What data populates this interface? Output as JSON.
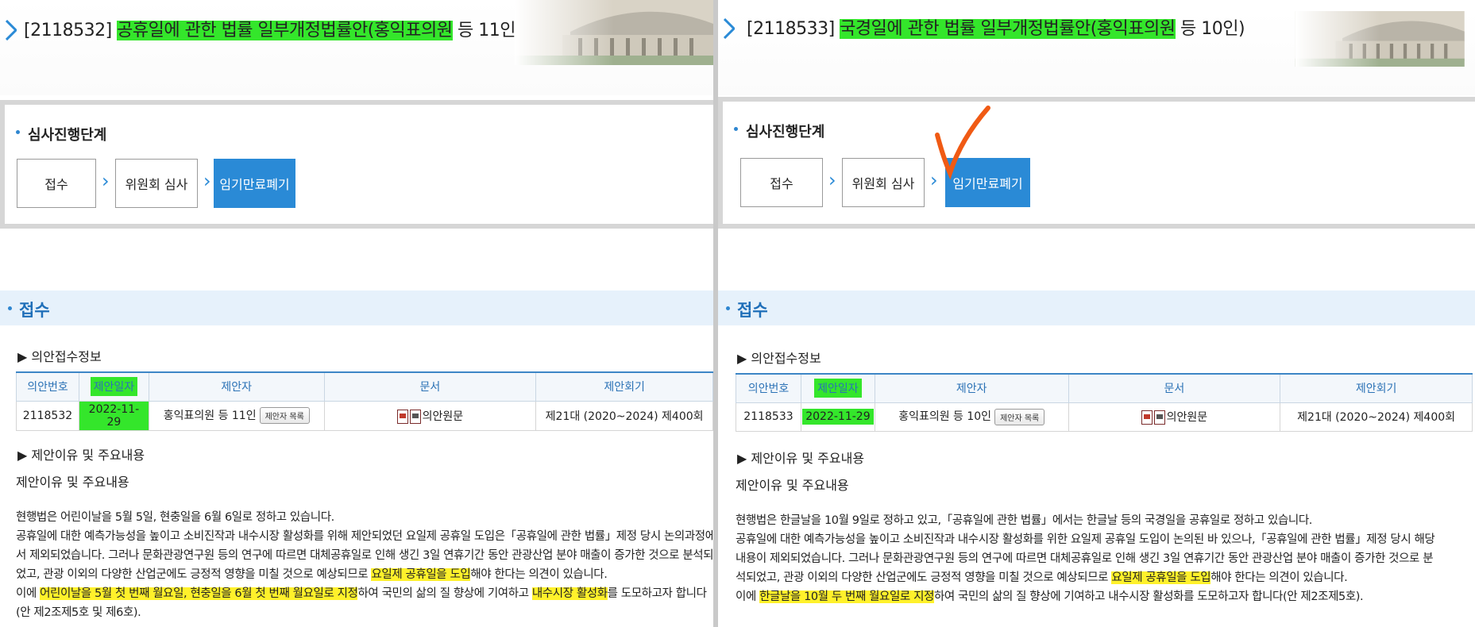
{
  "left": {
    "title_prefix": "[2118532] ",
    "title_highlighted": "공휴일에 관한 법률 일부개정법률안(홍익표의원",
    "title_suffix": " 등 11인)",
    "stage_heading": "심사진행단계",
    "stages": [
      "접수",
      "위원회 심사",
      "임기만료폐기"
    ],
    "section": "접수",
    "info_heading": "▶ 의안접수정보",
    "table_headers": [
      "의안번호",
      "제안일자",
      "제안자",
      "문서",
      "제안회기"
    ],
    "row": {
      "bill_no": "2118532",
      "date": "2022-11-29",
      "proposer": "홍익표의원 등 11인",
      "proposer_button": "제안자 목록",
      "doc": "의안원문",
      "session": "제21대 (2020~2024) 제400회"
    },
    "reason_heading": "▶ 제안이유 및 주요내용",
    "reason_label": "제안이유 및 주요내용",
    "line1": "현행법은 어린이날을 5월 5일, 현충일을 6월 6일로 정하고 있습니다.",
    "line2": "공휴일에 대한 예측가능성을 높이고 소비진작과 내수시장 활성화를 위해 제안되었던 요일제 공휴일 도입은「공휴일에 관한 법률」제정 당시 논의과정에",
    "line3": "서 제외되었습니다. 그러나 문화관광연구원 등의 연구에 따르면 대체공휴일로 인해 생긴 3일 연휴기간 동안 관광산업 분야 매출이 증가한 것으로 분석되",
    "line4_a": "었고, 관광 이외의 다양한 산업군에도 긍정적 영향을 미칠 것으로 예상되므로 ",
    "line4_hl": "요일제 공휴일을 도입",
    "line4_b": "해야 한다는 의견이 있습니다.",
    "line5_a": "이에 ",
    "line5_hl1": "어린이날을 5월 첫 번째 월요일, 현충일을 6월 첫 번째 월요일로 지정",
    "line5_b": "하여 국민의 삶의 질 향상에 기여하고 ",
    "line5_hl2": "내수시장 활성화",
    "line5_c": "를 도모하고자 합니다",
    "line6": "(안 제2조제5호 및 제6호)."
  },
  "right": {
    "title_prefix": "[2118533] ",
    "title_highlighted": "국경일에 관한 법률 일부개정법률안(홍익표의원",
    "title_suffix": " 등 10인)",
    "stage_heading": "심사진행단계",
    "stages": [
      "접수",
      "위원회 심사",
      "임기만료폐기"
    ],
    "section": "접수",
    "info_heading": "▶ 의안접수정보",
    "table_headers": [
      "의안번호",
      "제안일자",
      "제안자",
      "문서",
      "제안회기"
    ],
    "row": {
      "bill_no": "2118533",
      "date": "2022-11-29",
      "proposer": "홍익표의원 등 10인",
      "proposer_button": "제안자 목록",
      "doc": "의안원문",
      "session": "제21대 (2020~2024) 제400회"
    },
    "reason_heading": "▶ 제안이유 및 주요내용",
    "reason_label": "제안이유 및 주요내용",
    "line1": "현행법은 한글날을 10월 9일로 정하고 있고,「공휴일에 관한 법률」에서는 한글날 등의 국경일을 공휴일로 정하고 있습니다.",
    "line2": "공휴일에 대한 예측가능성을 높이고 소비진작과 내수시장 활성화를 위한 요일제 공휴일 도입이 논의된 바 있으나,「공휴일에 관한 법률」제정 당시 해당",
    "line3": "내용이 제외되었습니다. 그러나 문화관광연구원 등의 연구에 따르면 대체공휴일로 인해 생긴 3일 연휴기간 동안 관광산업 분야 매출이 증가한 것으로 분",
    "line4_a": "석되었고, 관광 이외의 다양한 산업군에도 긍정적 영향을 미칠 것으로 예상되므로 ",
    "line4_hl": "요일제 공휴일을 도입",
    "line4_b": "해야 한다는 의견이 있습니다.",
    "line5_a": "이에 ",
    "line5_hl1": "한글날을 10월 두 번째 월요일로 지정",
    "line5_b": "하여 국민의 삶의 질 향상에 기여하고 내수시장 활성화를 도모하고자 합니다(안 제2조제5호)."
  },
  "colors": {
    "accent": "#2a8ad6",
    "green_highlight": "#34e62b",
    "yellow_highlight": "#fff12b",
    "check_mark": "#f05a14"
  },
  "icons": [
    "chevron-right-icon",
    "hwp-doc-icon",
    "pdf-doc-icon",
    "check-mark-icon",
    "building-photo"
  ]
}
